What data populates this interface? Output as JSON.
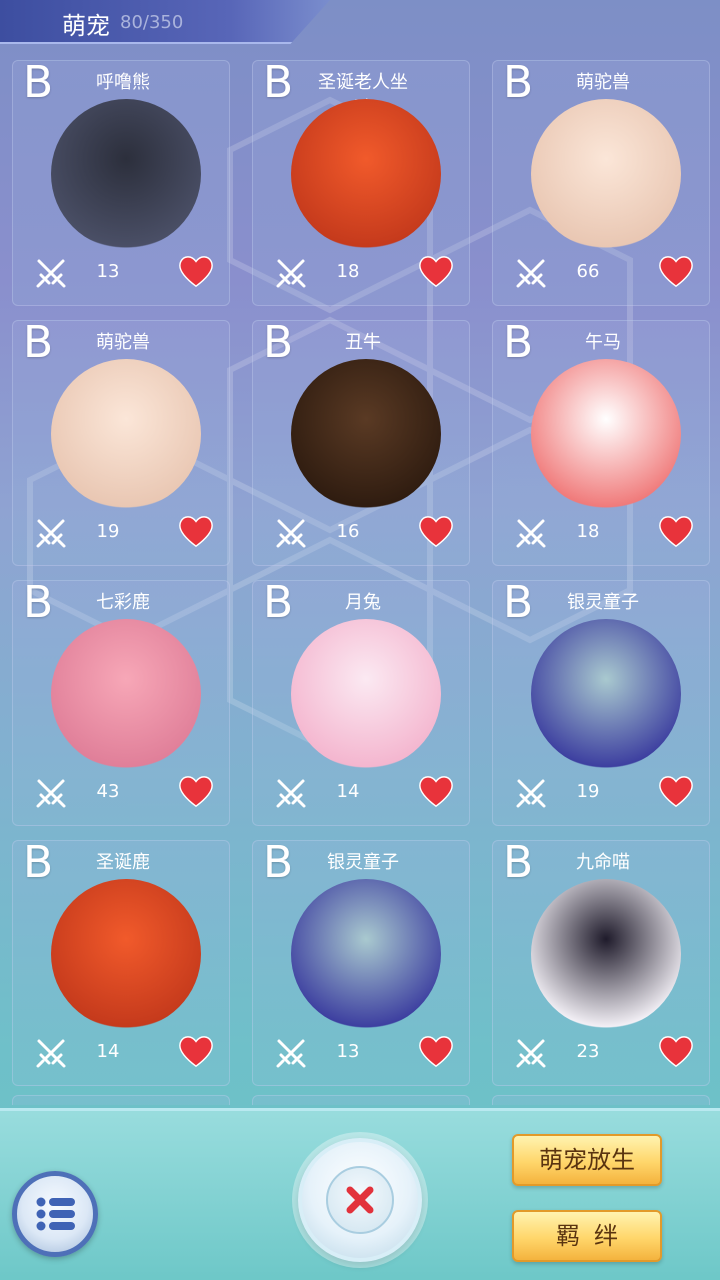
{
  "header": {
    "title": "萌宠",
    "count": "80/350"
  },
  "pets": [
    {
      "name": "呼噜熊",
      "grade": "B",
      "power": "13",
      "colors": [
        "#2c2f3c",
        "#4a4f66"
      ]
    },
    {
      "name": "圣诞老人坐骑",
      "grade": "B",
      "power": "18",
      "colors": [
        "#f15a2b",
        "#c53a1c"
      ]
    },
    {
      "name": "萌驼兽",
      "grade": "B",
      "power": "66",
      "colors": [
        "#fbe6d8",
        "#e9c7b3"
      ]
    },
    {
      "name": "萌驼兽",
      "grade": "B",
      "power": "19",
      "colors": [
        "#fbe6d8",
        "#e9c7b3"
      ]
    },
    {
      "name": "丑牛",
      "grade": "B",
      "power": "16",
      "colors": [
        "#5a3a24",
        "#2f1c10"
      ]
    },
    {
      "name": "午马",
      "grade": "B",
      "power": "18",
      "colors": [
        "#ffffff",
        "#f07a7a"
      ]
    },
    {
      "name": "七彩鹿",
      "grade": "B",
      "power": "43",
      "colors": [
        "#f7a7b7",
        "#e07f99"
      ]
    },
    {
      "name": "月兔",
      "grade": "B",
      "power": "14",
      "colors": [
        "#fbe9f2",
        "#f4b6cf"
      ]
    },
    {
      "name": "银灵童子",
      "grade": "B",
      "power": "19",
      "colors": [
        "#a9c9cf",
        "#3d3fa0"
      ]
    },
    {
      "name": "圣诞鹿",
      "grade": "B",
      "power": "14",
      "colors": [
        "#f15a2b",
        "#c53a1c"
      ]
    },
    {
      "name": "银灵童子",
      "grade": "B",
      "power": "13",
      "colors": [
        "#a9c9cf",
        "#3d3fa0"
      ]
    },
    {
      "name": "九命喵",
      "grade": "B",
      "power": "23",
      "colors": [
        "#1f1b2b",
        "#f3f0f6"
      ]
    }
  ],
  "buttons": {
    "release": "萌宠放生",
    "bond": "羁绊"
  },
  "icons": {
    "menu": "list-icon",
    "close": "close-icon",
    "battle": "crossed-swords-icon",
    "favorite": "heart-icon"
  },
  "colors": {
    "heart": "#e8333b",
    "close_x": "#e2323c",
    "menu_ring": "#4e70b8"
  }
}
